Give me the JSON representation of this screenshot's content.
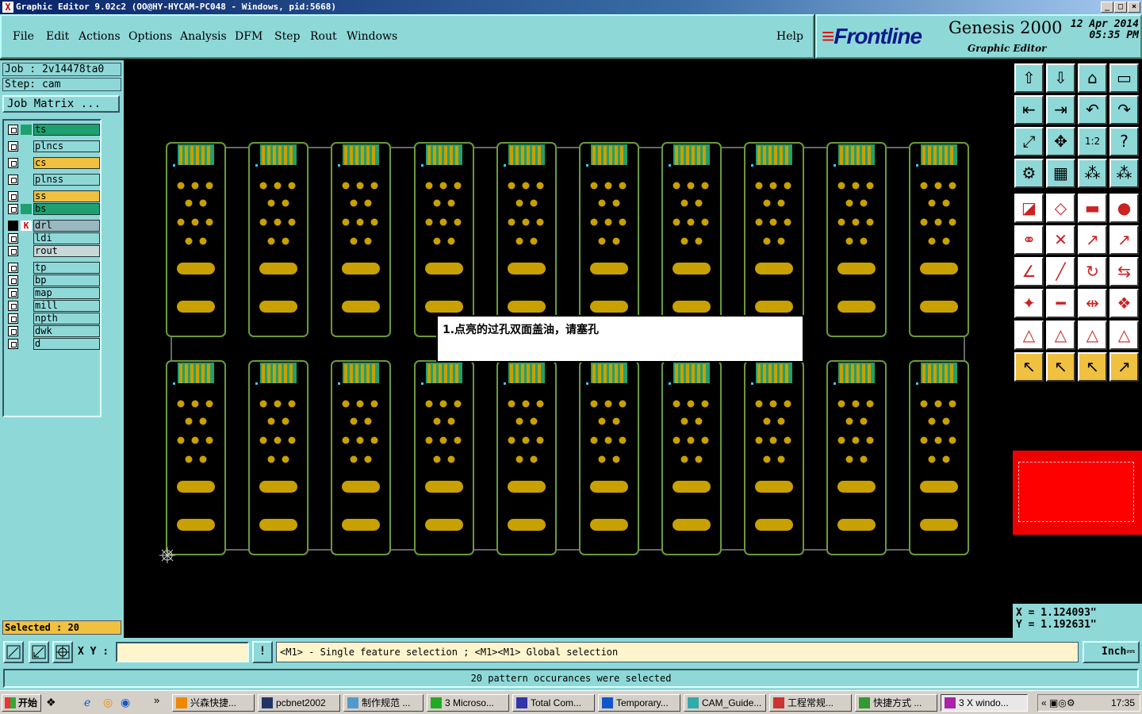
{
  "window": {
    "title": "Graphic Editor 9.02c2 (OO@HY-HYCAM-PC048 - Windows, pid:5668)",
    "controls": [
      "_",
      "□",
      "×"
    ]
  },
  "menu": {
    "items": [
      "File",
      "Edit",
      "Actions",
      "Options",
      "Analysis",
      "DFM",
      "Step",
      "Rout",
      "Windows"
    ],
    "help": "Help"
  },
  "brand": {
    "logo": "Frontline",
    "product": "Genesis 2000",
    "subtitle": "Graphic Editor",
    "date": "12 Apr 2014",
    "time": "05:35 PM"
  },
  "job": {
    "job_label": "Job : 2v14478ta0",
    "step_label": "Step: cam",
    "matrix_button": "Job Matrix ..."
  },
  "layers": [
    {
      "name": "ts",
      "color": "#20a070"
    },
    {
      "name": "plncs",
      "color": "#8fd8d8"
    },
    {
      "name": "cs",
      "color": "#f0c040"
    },
    {
      "name": "plnss",
      "color": "#8fd8d8"
    },
    {
      "name": "ss",
      "color": "#f0c040"
    },
    {
      "name": "bs",
      "color": "#20a070"
    },
    {
      "name": "drl",
      "color": "#9ab8c0"
    },
    {
      "name": "ldi",
      "color": "#8fd8d8"
    },
    {
      "name": "rout",
      "color": "#c8d8d8"
    },
    {
      "name": "tp",
      "color": "#8fd8d8"
    },
    {
      "name": "bp",
      "color": "#8fd8d8"
    },
    {
      "name": "map",
      "color": "#8fd8d8"
    },
    {
      "name": "mill",
      "color": "#8fd8d8"
    },
    {
      "name": "npth",
      "color": "#8fd8d8"
    },
    {
      "name": "dwk",
      "color": "#8fd8d8"
    },
    {
      "name": "d",
      "color": "#8fd8d8"
    }
  ],
  "selected": "Selected : 20",
  "note": "1.点亮的过孔双面盖油，请塞孔",
  "coords": {
    "x": "X = 1.124093\"",
    "y": "Y = 1.192631\""
  },
  "bottom": {
    "xy_label": "X Y :",
    "xy_value": "",
    "help_icon": "!",
    "help_message": "<M1> - Single feature selection ; <M1><M1> Global selection",
    "units": "Inch"
  },
  "status": "20 pattern occurances were selected",
  "taskbar": {
    "start": "开始",
    "tasks": [
      "兴森快捷...",
      "pcbnet2002",
      "制作规范 ...",
      "3 Microso...",
      "Total Com...",
      "Temporary...",
      "CAM_Guide...",
      "工程常规...",
      "快捷方式 ...",
      "3 X windo..."
    ],
    "clock": "17:35"
  },
  "colors": {
    "panel": "#8fd8d8",
    "board_outline": "#6a9a3a",
    "pad": "#c8a000",
    "minimap": "#e00000"
  }
}
